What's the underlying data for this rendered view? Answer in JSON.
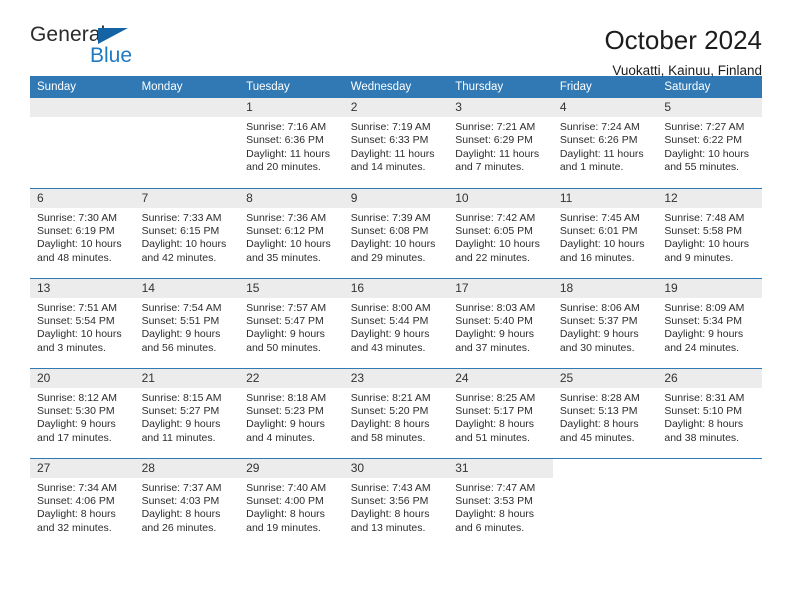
{
  "brand": {
    "name_top": "General",
    "name_bottom": "Blue",
    "triangle_color": "#1464a5",
    "accent_color": "#1f7ac4"
  },
  "header": {
    "title": "October 2024",
    "subtitle": "Vuokatti, Kainuu, Finland"
  },
  "theme": {
    "header_bg": "#3079b5",
    "header_text": "#ffffff",
    "daynum_bg": "#ececec",
    "rule_color": "#3079b5",
    "page_bg": "#ffffff"
  },
  "weekdays": [
    "Sunday",
    "Monday",
    "Tuesday",
    "Wednesday",
    "Thursday",
    "Friday",
    "Saturday"
  ],
  "labels": {
    "sunrise_prefix": "Sunrise:",
    "sunset_prefix": "Sunset:",
    "daylight_prefix": "Daylight:"
  },
  "weeks": [
    [
      {
        "day": "",
        "sunrise": "",
        "sunset": "",
        "daylight": "",
        "empty": true
      },
      {
        "day": "",
        "sunrise": "",
        "sunset": "",
        "daylight": "",
        "empty": true
      },
      {
        "day": "1",
        "sunrise": "Sunrise: 7:16 AM",
        "sunset": "Sunset: 6:36 PM",
        "daylight": "Daylight: 11 hours and 20 minutes."
      },
      {
        "day": "2",
        "sunrise": "Sunrise: 7:19 AM",
        "sunset": "Sunset: 6:33 PM",
        "daylight": "Daylight: 11 hours and 14 minutes."
      },
      {
        "day": "3",
        "sunrise": "Sunrise: 7:21 AM",
        "sunset": "Sunset: 6:29 PM",
        "daylight": "Daylight: 11 hours and 7 minutes."
      },
      {
        "day": "4",
        "sunrise": "Sunrise: 7:24 AM",
        "sunset": "Sunset: 6:26 PM",
        "daylight": "Daylight: 11 hours and 1 minute."
      },
      {
        "day": "5",
        "sunrise": "Sunrise: 7:27 AM",
        "sunset": "Sunset: 6:22 PM",
        "daylight": "Daylight: 10 hours and 55 minutes."
      }
    ],
    [
      {
        "day": "6",
        "sunrise": "Sunrise: 7:30 AM",
        "sunset": "Sunset: 6:19 PM",
        "daylight": "Daylight: 10 hours and 48 minutes."
      },
      {
        "day": "7",
        "sunrise": "Sunrise: 7:33 AM",
        "sunset": "Sunset: 6:15 PM",
        "daylight": "Daylight: 10 hours and 42 minutes."
      },
      {
        "day": "8",
        "sunrise": "Sunrise: 7:36 AM",
        "sunset": "Sunset: 6:12 PM",
        "daylight": "Daylight: 10 hours and 35 minutes."
      },
      {
        "day": "9",
        "sunrise": "Sunrise: 7:39 AM",
        "sunset": "Sunset: 6:08 PM",
        "daylight": "Daylight: 10 hours and 29 minutes."
      },
      {
        "day": "10",
        "sunrise": "Sunrise: 7:42 AM",
        "sunset": "Sunset: 6:05 PM",
        "daylight": "Daylight: 10 hours and 22 minutes."
      },
      {
        "day": "11",
        "sunrise": "Sunrise: 7:45 AM",
        "sunset": "Sunset: 6:01 PM",
        "daylight": "Daylight: 10 hours and 16 minutes."
      },
      {
        "day": "12",
        "sunrise": "Sunrise: 7:48 AM",
        "sunset": "Sunset: 5:58 PM",
        "daylight": "Daylight: 10 hours and 9 minutes."
      }
    ],
    [
      {
        "day": "13",
        "sunrise": "Sunrise: 7:51 AM",
        "sunset": "Sunset: 5:54 PM",
        "daylight": "Daylight: 10 hours and 3 minutes."
      },
      {
        "day": "14",
        "sunrise": "Sunrise: 7:54 AM",
        "sunset": "Sunset: 5:51 PM",
        "daylight": "Daylight: 9 hours and 56 minutes."
      },
      {
        "day": "15",
        "sunrise": "Sunrise: 7:57 AM",
        "sunset": "Sunset: 5:47 PM",
        "daylight": "Daylight: 9 hours and 50 minutes."
      },
      {
        "day": "16",
        "sunrise": "Sunrise: 8:00 AM",
        "sunset": "Sunset: 5:44 PM",
        "daylight": "Daylight: 9 hours and 43 minutes."
      },
      {
        "day": "17",
        "sunrise": "Sunrise: 8:03 AM",
        "sunset": "Sunset: 5:40 PM",
        "daylight": "Daylight: 9 hours and 37 minutes."
      },
      {
        "day": "18",
        "sunrise": "Sunrise: 8:06 AM",
        "sunset": "Sunset: 5:37 PM",
        "daylight": "Daylight: 9 hours and 30 minutes."
      },
      {
        "day": "19",
        "sunrise": "Sunrise: 8:09 AM",
        "sunset": "Sunset: 5:34 PM",
        "daylight": "Daylight: 9 hours and 24 minutes."
      }
    ],
    [
      {
        "day": "20",
        "sunrise": "Sunrise: 8:12 AM",
        "sunset": "Sunset: 5:30 PM",
        "daylight": "Daylight: 9 hours and 17 minutes."
      },
      {
        "day": "21",
        "sunrise": "Sunrise: 8:15 AM",
        "sunset": "Sunset: 5:27 PM",
        "daylight": "Daylight: 9 hours and 11 minutes."
      },
      {
        "day": "22",
        "sunrise": "Sunrise: 8:18 AM",
        "sunset": "Sunset: 5:23 PM",
        "daylight": "Daylight: 9 hours and 4 minutes."
      },
      {
        "day": "23",
        "sunrise": "Sunrise: 8:21 AM",
        "sunset": "Sunset: 5:20 PM",
        "daylight": "Daylight: 8 hours and 58 minutes."
      },
      {
        "day": "24",
        "sunrise": "Sunrise: 8:25 AM",
        "sunset": "Sunset: 5:17 PM",
        "daylight": "Daylight: 8 hours and 51 minutes."
      },
      {
        "day": "25",
        "sunrise": "Sunrise: 8:28 AM",
        "sunset": "Sunset: 5:13 PM",
        "daylight": "Daylight: 8 hours and 45 minutes."
      },
      {
        "day": "26",
        "sunrise": "Sunrise: 8:31 AM",
        "sunset": "Sunset: 5:10 PM",
        "daylight": "Daylight: 8 hours and 38 minutes."
      }
    ],
    [
      {
        "day": "27",
        "sunrise": "Sunrise: 7:34 AM",
        "sunset": "Sunset: 4:06 PM",
        "daylight": "Daylight: 8 hours and 32 minutes."
      },
      {
        "day": "28",
        "sunrise": "Sunrise: 7:37 AM",
        "sunset": "Sunset: 4:03 PM",
        "daylight": "Daylight: 8 hours and 26 minutes."
      },
      {
        "day": "29",
        "sunrise": "Sunrise: 7:40 AM",
        "sunset": "Sunset: 4:00 PM",
        "daylight": "Daylight: 8 hours and 19 minutes."
      },
      {
        "day": "30",
        "sunrise": "Sunrise: 7:43 AM",
        "sunset": "Sunset: 3:56 PM",
        "daylight": "Daylight: 8 hours and 13 minutes."
      },
      {
        "day": "31",
        "sunrise": "Sunrise: 7:47 AM",
        "sunset": "Sunset: 3:53 PM",
        "daylight": "Daylight: 8 hours and 6 minutes."
      },
      {
        "day": "",
        "sunrise": "",
        "sunset": "",
        "daylight": "",
        "blank": true
      },
      {
        "day": "",
        "sunrise": "",
        "sunset": "",
        "daylight": "",
        "blank": true
      }
    ]
  ]
}
